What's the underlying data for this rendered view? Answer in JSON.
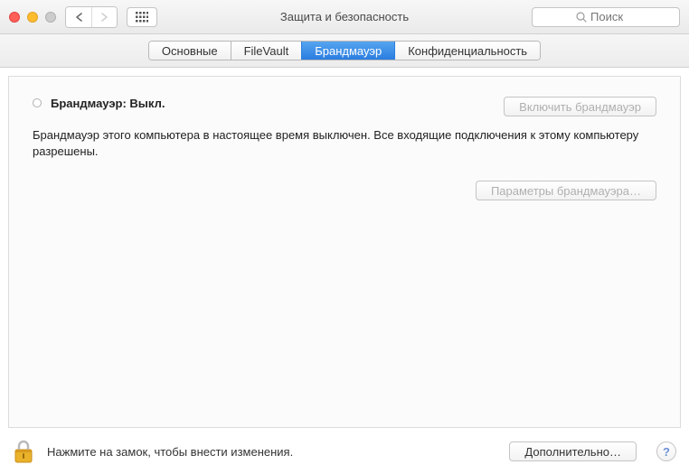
{
  "window": {
    "title": "Защита и безопасность",
    "search_placeholder": "Поиск"
  },
  "tabs": [
    {
      "label": "Основные",
      "active": false
    },
    {
      "label": "FileVault",
      "active": false
    },
    {
      "label": "Брандмауэр",
      "active": true
    },
    {
      "label": "Конфиденциальность",
      "active": false
    }
  ],
  "firewall": {
    "status_label": "Брандмауэр: Выкл.",
    "enable_button": "Включить брандмауэр",
    "description": "Брандмауэр этого компьютера в настоящее время выключен. Все входящие подключения к этому компьютеру разрешены.",
    "options_button": "Параметры брандмауэра…"
  },
  "footer": {
    "lock_text": "Нажмите на замок, чтобы внести изменения.",
    "advanced_button": "Дополнительно…",
    "help_label": "?"
  }
}
